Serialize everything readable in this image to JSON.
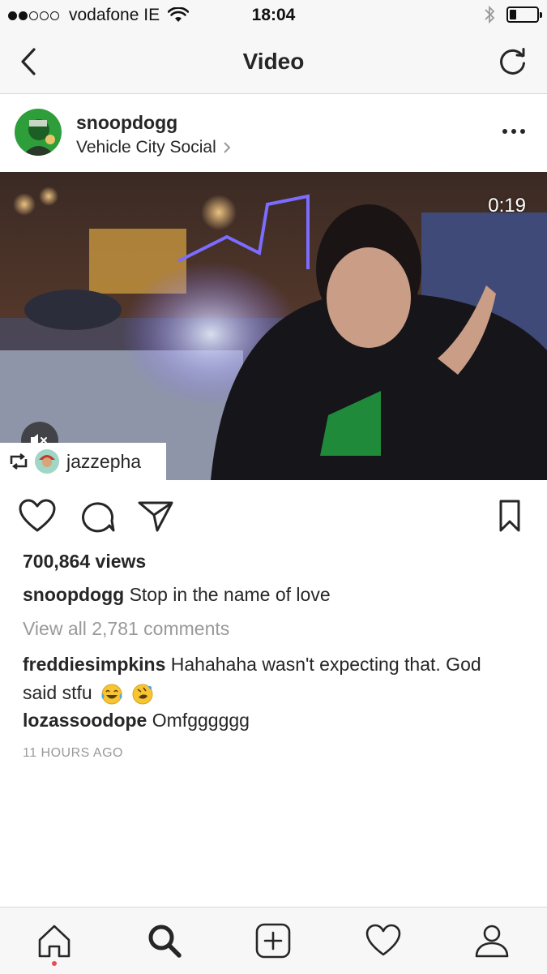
{
  "status_bar": {
    "carrier": "vodafone IE",
    "time": "18:04",
    "signal_bars_filled": 2,
    "signal_bars_total": 5,
    "battery_level": 0.25
  },
  "nav": {
    "title": "Video",
    "back_icon": "chevron-left-icon",
    "refresh_icon": "refresh-icon"
  },
  "post": {
    "username": "snoopdogg",
    "location": "Vehicle City Social",
    "video": {
      "duration": "0:19",
      "muted": true
    },
    "repost": {
      "username": "jazzepha"
    },
    "views": "700,864 views",
    "caption": {
      "username": "snoopdogg",
      "text": "Stop in the name of love"
    },
    "view_all_comments": "View all 2,781 comments",
    "comments": [
      {
        "username": "freddiesimpkins",
        "text": "Hahahaha wasn't expecting that. God said stfu",
        "emojis": [
          "face-with-tears-of-joy",
          "rolling-on-the-floor-laughing"
        ]
      },
      {
        "username": "lozassoodope",
        "text": "Omfgggggg"
      }
    ],
    "timestamp": "11 HOURS AGO"
  },
  "tab_bar": {
    "items": [
      "home-icon",
      "search-icon",
      "add-icon",
      "heart-icon",
      "profile-icon"
    ],
    "active": "home-icon",
    "active_color": "#ed4956"
  }
}
